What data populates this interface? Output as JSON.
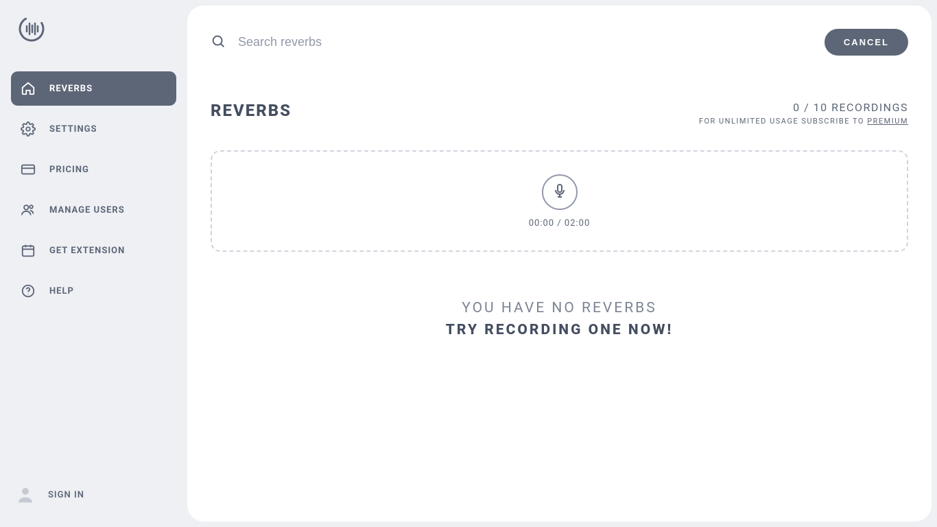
{
  "sidebar": {
    "items": [
      {
        "label": "Reverbs"
      },
      {
        "label": "Settings"
      },
      {
        "label": "Pricing"
      },
      {
        "label": "Manage Users"
      },
      {
        "label": "Get Extension"
      },
      {
        "label": "Help"
      }
    ],
    "signin_label": "Sign In"
  },
  "search": {
    "placeholder": "Search reverbs",
    "cancel_label": "CANCEL"
  },
  "section": {
    "title": "REVERBS",
    "usage_count": "0 / 10 RECORDINGS",
    "usage_cta_prefix": "FOR UNLIMITED USAGE SUBSCRIBE TO ",
    "usage_cta_link": "PREMIUM"
  },
  "recorder": {
    "timer": "00:00 / 02:00"
  },
  "empty": {
    "line1": "YOU HAVE NO REVERBS",
    "line2": "TRY RECORDING ONE NOW!"
  }
}
